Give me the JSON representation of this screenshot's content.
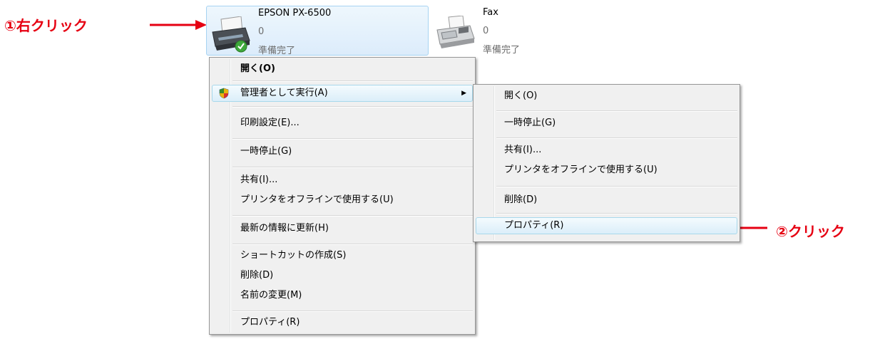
{
  "annotations": {
    "step1": "①右クリック",
    "step2": "②クリック",
    "color": "#e60012"
  },
  "printers": [
    {
      "name": "EPSON PX-6500",
      "count": "0",
      "status": "準備完了",
      "icon": "printer-icon",
      "selected": true
    },
    {
      "name": "Fax",
      "count": "0",
      "status": "準備完了",
      "icon": "fax-icon",
      "selected": false
    }
  ],
  "context_menu": {
    "open": "開く(O)",
    "run_as_admin": "管理者として実行(A)",
    "print_settings": "印刷設定(E)...",
    "pause": "一時停止(G)",
    "share": "共有(I)...",
    "use_offline": "プリンタをオフラインで使用する(U)",
    "refresh": "最新の情報に更新(H)",
    "create_shortcut": "ショートカットの作成(S)",
    "delete": "削除(D)",
    "rename": "名前の変更(M)",
    "properties": "プロパティ(R)"
  },
  "submenu": {
    "open": "開く(O)",
    "pause": "一時停止(G)",
    "share": "共有(I)...",
    "use_offline": "プリンタをオフラインで使用する(U)",
    "delete": "削除(D)",
    "properties": "プロパティ(R)"
  },
  "colors": {
    "selection_border": "#a6d3f2",
    "menu_background": "#f0f0f0",
    "menu_hover_border": "#a8d8eb"
  }
}
